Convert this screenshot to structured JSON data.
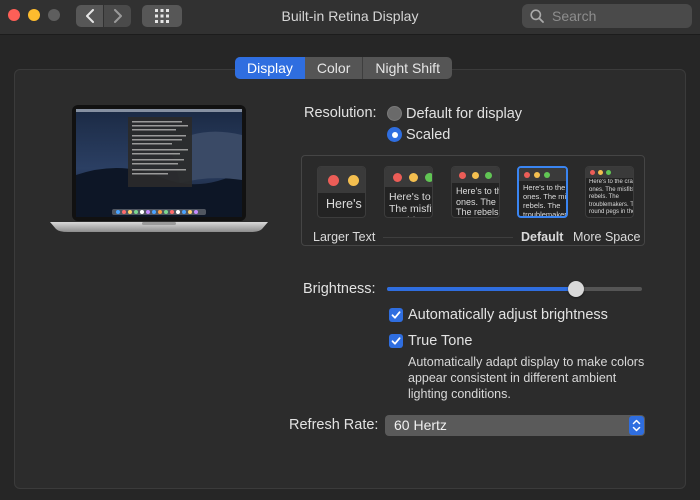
{
  "window": {
    "title": "Built-in Retina Display",
    "search_placeholder": "Search"
  },
  "tabs": [
    {
      "label": "Display",
      "active": true
    },
    {
      "label": "Color",
      "active": false
    },
    {
      "label": "Night Shift",
      "active": false
    }
  ],
  "resolution": {
    "label": "Resolution:",
    "options": [
      {
        "label": "Default for display",
        "selected": false
      },
      {
        "label": "Scaled",
        "selected": true
      }
    ],
    "scale_labels": {
      "left": "Larger Text",
      "middle": "Default",
      "right": "More Space"
    },
    "sample_text": "Here's to the crazy ones. The misfits. The rebels. The troublemakers. The round pegs in the square holes. The ones who see things differently. They're not fond of rules. And they have no respect for the status quo. About the only thing you can't do is ignore them. Because they change things."
  },
  "brightness": {
    "label": "Brightness:",
    "value_fraction": 0.74,
    "auto_adjust": {
      "label": "Automatically adjust brightness",
      "checked": true
    },
    "true_tone": {
      "label": "True Tone",
      "checked": true
    },
    "true_tone_desc_lines": [
      "Automatically adapt display to make colors",
      "appear consistent in different ambient",
      "lighting conditions."
    ]
  },
  "refresh_rate": {
    "label": "Refresh Rate:",
    "value": "60 Hertz"
  },
  "colors": {
    "accent": "#2f6ee0",
    "close": "#fe5f57",
    "minimize": "#febc2e"
  }
}
